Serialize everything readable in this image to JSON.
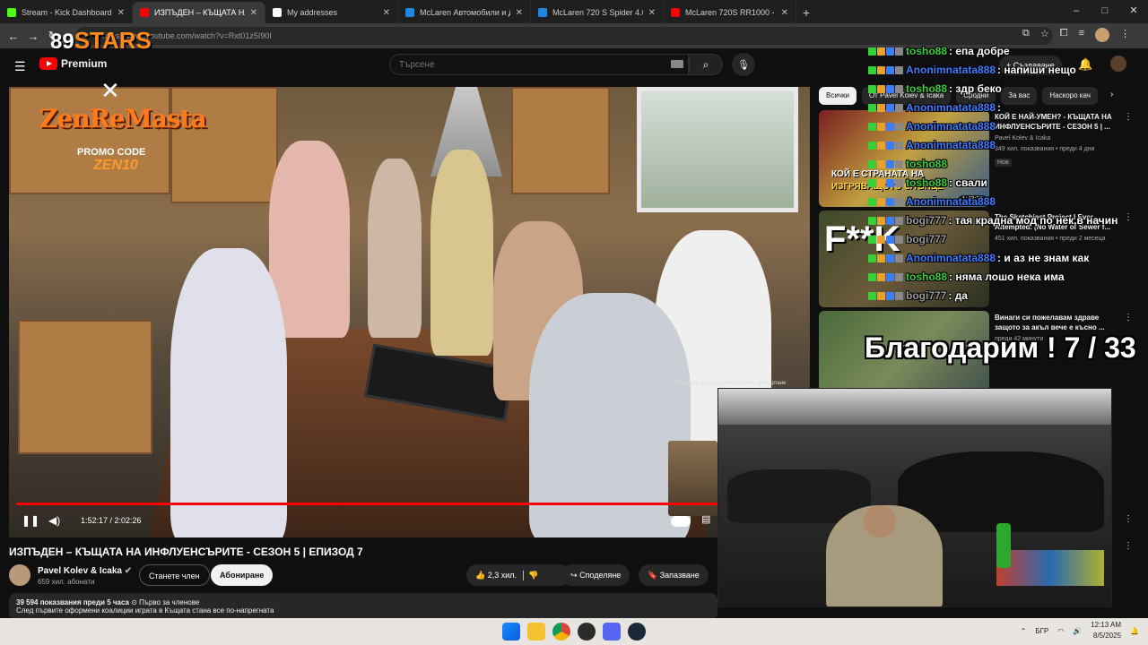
{
  "browser": {
    "tabs": [
      {
        "title": "Stream - Kick Dashboard",
        "color": "#53fc18",
        "active": false
      },
      {
        "title": "ИЗПЪДЕН – КЪЩАТА НА И",
        "color": "#ff0000",
        "active": true
      },
      {
        "title": "My addresses",
        "color": "#ffffff",
        "active": false
      },
      {
        "title": "McLaren Автомобили и Джипа",
        "color": "#1e88e5",
        "active": false
      },
      {
        "title": "McLaren 720 S Spider 4.0 V8 Sp",
        "color": "#1e88e5",
        "active": false
      },
      {
        "title": "McLaren 720S RR1000 - Wild S",
        "color": "#ff0000",
        "active": false
      }
    ],
    "url": "https://www.youtube.com/watch?v=Rxt01z5I90I",
    "window_controls": [
      "–",
      "□",
      "✕"
    ]
  },
  "youtube": {
    "logo_text": "Premium",
    "search_placeholder": "Търсене",
    "create_label": "+ Създаване",
    "video": {
      "title": "ИЗПЪДЕН – КЪЩАТА НА ИНФЛУЕНСЪРИТЕ - СЕЗОН 5 | ЕПИЗОД 7",
      "time": "1:52:17 / 2:02:26",
      "progress": 0.917,
      "overlay_text": "Плъзнете, за да видите обратно превъртане",
      "channel_name": "Pavel Kolev & Icaka",
      "channel_subs": "659 хил. абонати",
      "join_label": "Станете член",
      "subscribe_label": "Абониране",
      "likes": "2,3 хил.",
      "share_label": "Споделяне",
      "save_label": "Запазване",
      "views": "39 594 показвания  преди 5 часа",
      "members_first": "Първо за членове",
      "desc_line": "След първите оформени коалиции играта в Къщата стана все по-напрегната"
    },
    "chips": [
      "Всички",
      "От Pavel Kolev & Icaka",
      "Сродни",
      "За вас",
      "Наскоро кач"
    ],
    "recommendations": [
      {
        "title": "КОЙ Е НАЙ-УМЕН? - КЪЩАТА НА ИНФЛУЕНСЪРИТЕ - СЕЗОН 5 | ...",
        "channel": "Pavel Kolev & Icaka",
        "meta": "349 хил. показвания • преди 4 дни",
        "badge": "Нов",
        "duration": "1:43:28"
      },
      {
        "title": "The Sketchiest Project I Ever Attempted. (No Water or Sewer f...",
        "channel": "",
        "meta": "451 хил. показвания • преди 2 месеца",
        "badge": "",
        "duration": ""
      },
      {
        "title": "Винаги си пожелавам здраве защото за акъл вече е късно ...",
        "channel": "",
        "meta": "преди 42 минути",
        "badge": "Нов",
        "duration": ""
      }
    ]
  },
  "overlay": {
    "logo_num": "89",
    "logo_word": "STARS",
    "cross": "✕",
    "zen": "ZenReMasta",
    "promo": "PROMO CODE",
    "code": "ZEN10",
    "thanks": "Благодарим ! 7 / 33",
    "thumb_text_1": "КОЙ Е СТРАНАТА НА",
    "thumb_text_2": "ИЗГРЯВАЩОТО СЛЪНЦЕ",
    "thumb_text_3": "F**K",
    "chat": [
      {
        "user": "tosho88",
        "text": ": епа добре",
        "color": "#36d136"
      },
      {
        "user": "Anonimnatata888",
        "text": ": напиши нещо",
        "color": "#3c7cff"
      },
      {
        "user": "tosho88",
        "text": ": здр беко",
        "color": "#36d136"
      },
      {
        "user": "Anonimnatata888",
        "text": ": ",
        "color": "#3c7cff"
      },
      {
        "user": "Anonimnatata888",
        "text": "",
        "color": "#3c7cff"
      },
      {
        "user": "Anonimnatata888",
        "text": "",
        "color": "#3c7cff"
      },
      {
        "user": "tosho88",
        "text": "",
        "color": "#36d136"
      },
      {
        "user": "tosho88",
        "text": ": свали",
        "color": "#36d136"
      },
      {
        "user": "Anonimnatata888",
        "text": "",
        "color": "#3c7cff"
      },
      {
        "user": "bogi777",
        "text": ": тая крадна мод по нек,в начин",
        "color": "#9b9b9b"
      },
      {
        "user": "bogi777",
        "text": "",
        "color": "#9b9b9b"
      },
      {
        "user": "Anonimnatata888",
        "text": ": и аз не знам как",
        "color": "#3c7cff"
      },
      {
        "user": "tosho88",
        "text": ": няма лошо нека има",
        "color": "#36d136"
      },
      {
        "user": "bogi777",
        "text": ": да",
        "color": "#9b9b9b"
      }
    ]
  },
  "taskbar": {
    "lang": "БГР",
    "time": "12:13 AM",
    "date": "8/5/2025"
  }
}
